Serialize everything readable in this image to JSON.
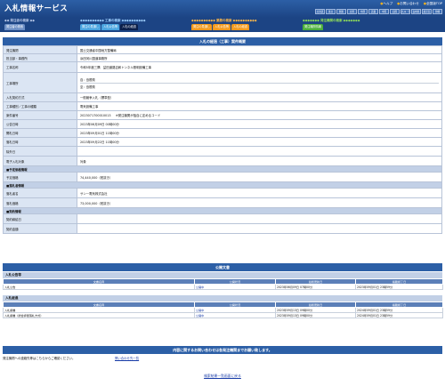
{
  "header": {
    "title": "入札情報サービス",
    "links": [
      {
        "label": "ヘルプ"
      },
      {
        "label": "お問い合わせ"
      },
      {
        "label": "全国版TOP"
      }
    ],
    "regions": [
      "北海道",
      "東北",
      "関東",
      "北陸",
      "中部",
      "近畿",
      "中国",
      "四国",
      "九州・沖縄",
      "長崎県",
      "鹿児島",
      "沖縄"
    ]
  },
  "nav": {
    "groups": [
      {
        "title": "発注者の検索",
        "tabs": [
          "発注者の検索"
        ]
      },
      {
        "title": "工事の検索",
        "tabs": [
          "発注の見通し",
          "入札公告等",
          "入札の経過"
        ]
      },
      {
        "title": "業務の検索",
        "tabs": [
          "発注の見通し",
          "入札公告等",
          "入札の経過"
        ]
      },
      {
        "title": "発注機関の検索",
        "tabs": [
          "発注機関情報"
        ]
      }
    ]
  },
  "section_title": "入札の経過（工事）案件概要",
  "details": {
    "orderer": {
      "label": "発注機関",
      "value": "国土交通省中国地方整備局"
    },
    "office": {
      "label": "担当部・事務所",
      "value": "浜田河川国道事務所"
    },
    "project": {
      "label": "工事名称",
      "value": "令和5年度三隅　益田道路吉和トンネル照明設備工事"
    },
    "location": {
      "label": "工事場所",
      "lines": [
        "自：島根県",
        "至：島根県"
      ]
    },
    "method": {
      "label": "入札契約方式",
      "value": "一般競争入札（標準型）"
    },
    "category": {
      "label": "工事種別／工事の種類",
      "value": "電気設備工事"
    },
    "case_no": {
      "label": "案件番号",
      "value": "2023071700010013",
      "note": "※発注機関が独自に定めるコード"
    },
    "pub_date": {
      "label": "公告日時",
      "value": "2023年06月09日 00時00分"
    },
    "open_date": {
      "label": "開札日時",
      "value": "2023年09月01日 11時00分"
    },
    "award_date": {
      "label": "落札日時",
      "value": "2023年09月22日 11時00分"
    },
    "excluded": {
      "label": "除外日",
      "value": ""
    },
    "e_bid": {
      "label": "電子入札対象",
      "value": "対象"
    },
    "est_header": "予定価格情報",
    "est_price": {
      "label": "予定価格",
      "value": "74,440,000（税抜き）"
    },
    "winner_header": "落札者情報",
    "winner_name": {
      "label": "落札者名",
      "value": "サンー電気株式会社"
    },
    "winner_price": {
      "label": "落札価格",
      "value": "73,000,000（税抜き）"
    },
    "contract_header": "契約情報",
    "contract_date": {
      "label": "契約締結日",
      "value": ""
    },
    "contract_amount": {
      "label": "契約金額",
      "value": ""
    }
  },
  "documents": {
    "title": "公開文書",
    "columns": [
      "文書名称",
      "公開状況",
      "最終更新日",
      "掲載終了日"
    ],
    "notice": {
      "header": "入札公告等",
      "rows": [
        {
          "name": "入札公告",
          "status": "公開中",
          "updated": "2023年06月09日 07時00分",
          "end": "2023年09月01日 23時59分"
        }
      ]
    },
    "process": {
      "header": "入札経過",
      "rows": [
        {
          "name": "入札調書",
          "status": "公開中",
          "updated": "2023年09月13日 09時00分",
          "end": "2024年09月01日 23時59分"
        },
        {
          "name": "入札調書（総合評価落札方式）",
          "status": "公開中",
          "updated": "2023年09月13日 09時00分",
          "end": "2024年09月01日 23時59分"
        }
      ]
    }
  },
  "inquiry": {
    "title": "内容に関するお問い合わせは各発注機関までお願い致します。",
    "note": "発注機関への連絡先等はこちらからご確認ください。",
    "link": "問い合わせ先一覧"
  },
  "back_link": "検索結果一覧画面に戻る",
  "colors": {
    "header": "#2c5fa6",
    "nav": "#1c4484",
    "construction_tab": "#4aa5e0",
    "service_tab": "#f39a1d",
    "agency_tab": "#4caf3c"
  }
}
